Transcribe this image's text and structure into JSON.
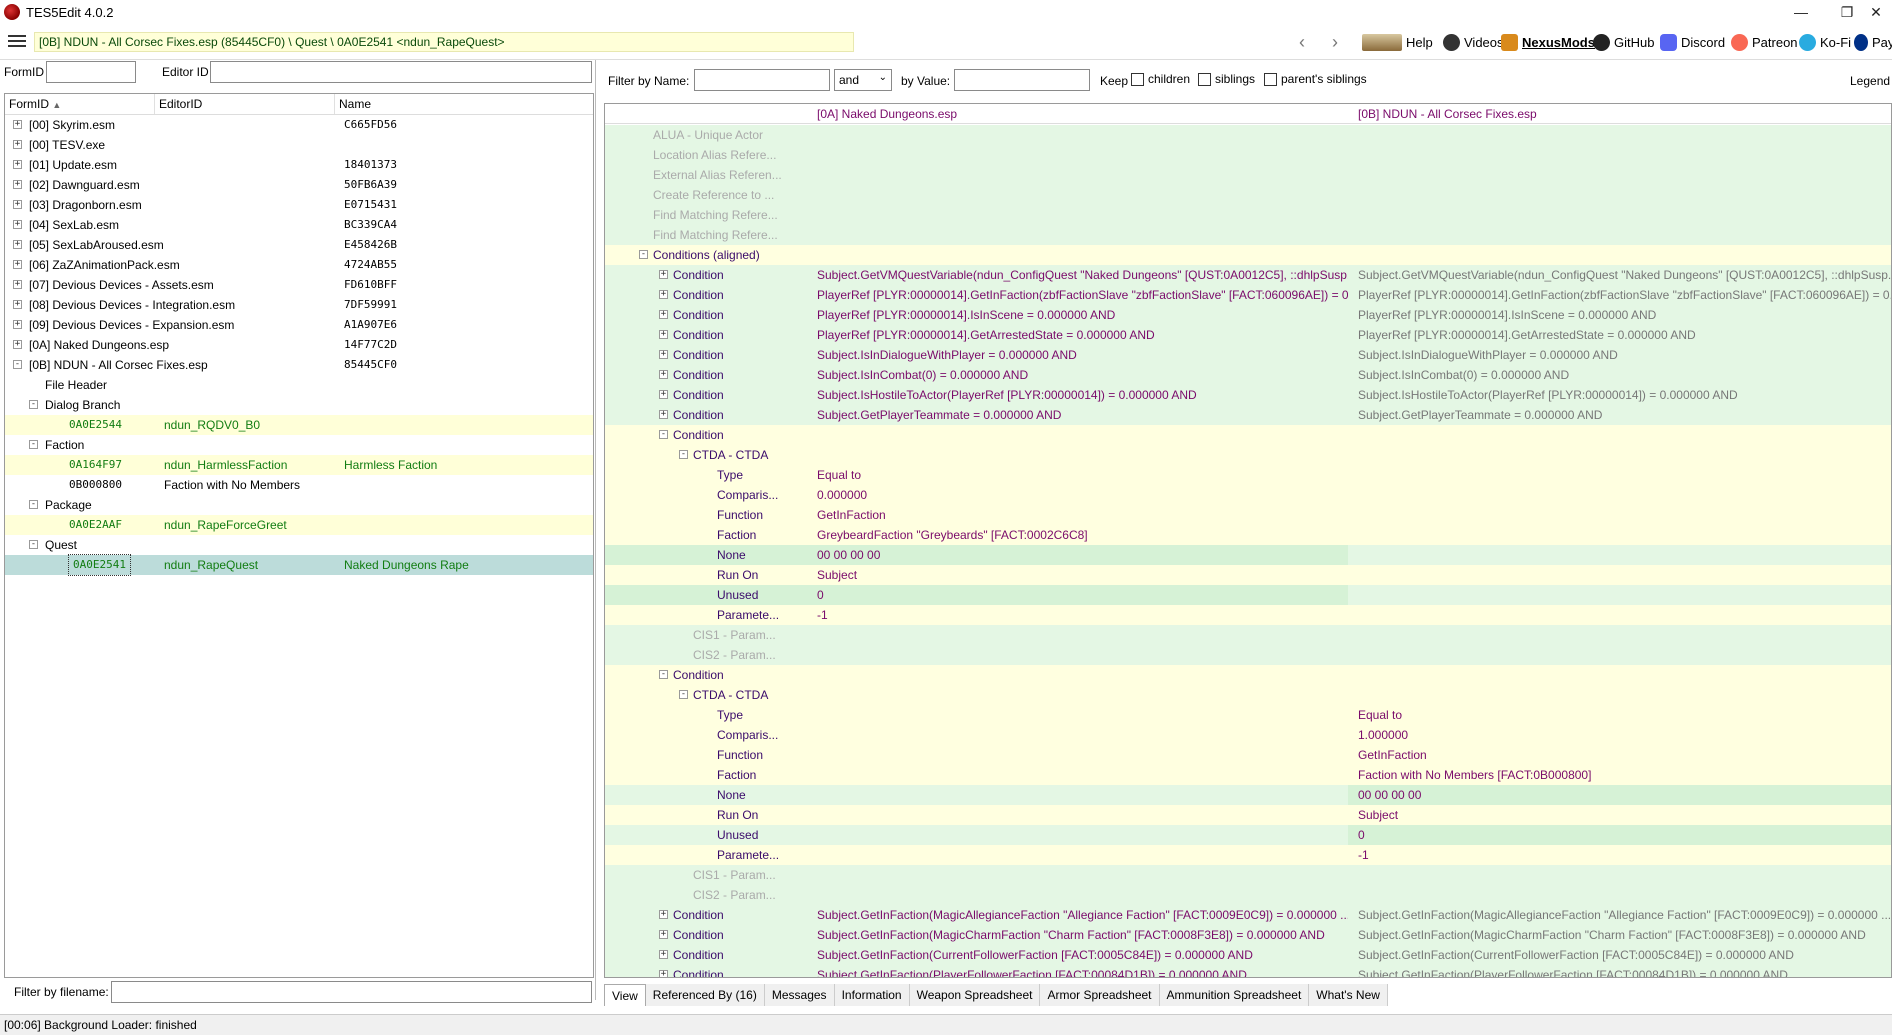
{
  "window": {
    "title": "TES5Edit 4.0.2"
  },
  "toolbar": {
    "path": "[0B] NDUN - All Corsec Fixes.esp (85445CF0) \\ Quest \\ 0A0E2541 <ndun_RapeQuest>",
    "links": [
      "Help",
      "Videos",
      "NexusMods",
      "GitHub",
      "Discord",
      "Patreon",
      "Ko-Fi",
      "Pay"
    ]
  },
  "left": {
    "formid_label": "FormID",
    "editorid_label": "Editor ID",
    "columns": [
      "FormID",
      "EditorID",
      "Name"
    ],
    "filter_label": "Filter by filename:",
    "rows": [
      {
        "label": "[00] Skyrim.esm",
        "id": "C665FD56",
        "name": ""
      },
      {
        "label": "[00] TESV.exe",
        "id": "",
        "name": ""
      },
      {
        "label": "[01] Update.esm",
        "id": "18401373",
        "name": ""
      },
      {
        "label": "[02] Dawnguard.esm",
        "id": "50FB6A39",
        "name": ""
      },
      {
        "label": "[03] Dragonborn.esm",
        "id": "E0715431",
        "name": ""
      },
      {
        "label": "[04] SexLab.esm",
        "id": "BC339CA4",
        "name": ""
      },
      {
        "label": "[05] SexLabAroused.esm",
        "id": "E458426B",
        "name": ""
      },
      {
        "label": "[06] ZaZAnimationPack.esm",
        "id": "4724AB55",
        "name": ""
      },
      {
        "label": "[07] Devious Devices - Assets.esm",
        "id": "FD610BFF",
        "name": ""
      },
      {
        "label": "[08] Devious Devices - Integration.esm",
        "id": "7DF59991",
        "name": ""
      },
      {
        "label": "[09] Devious Devices - Expansion.esm",
        "id": "A1A907E6",
        "name": ""
      },
      {
        "label": "[0A] Naked Dungeons.esp",
        "id": "14F77C2D",
        "name": ""
      },
      {
        "label": "[0B] NDUN - All Corsec Fixes.esp",
        "id": "85445CF0",
        "name": ""
      },
      {
        "label": "File Header",
        "id": "",
        "name": ""
      },
      {
        "label": "Dialog Branch",
        "id": "",
        "name": ""
      },
      {
        "label": "0A0E2544",
        "id": "ndun_RQDV0_B0",
        "name": ""
      },
      {
        "label": "Faction",
        "id": "",
        "name": ""
      },
      {
        "label": "0A164F97",
        "id": "ndun_HarmlessFaction",
        "name": "Harmless Faction"
      },
      {
        "label": "0B000800",
        "id": "Faction with No Members",
        "name": ""
      },
      {
        "label": "Package",
        "id": "",
        "name": ""
      },
      {
        "label": "0A0E2AAF",
        "id": "ndun_RapeForceGreet",
        "name": ""
      },
      {
        "label": "Quest",
        "id": "",
        "name": ""
      },
      {
        "label": "0A0E2541",
        "id": "ndun_RapeQuest",
        "name": "Naked Dungeons Rape"
      }
    ]
  },
  "right": {
    "filter_name_label": "Filter by Name:",
    "and_label": "and",
    "by_value_label": "by Value:",
    "keep_label": "Keep",
    "children_label": "children",
    "siblings_label": "siblings",
    "parents_label": "parent's siblings",
    "legend_label": "Legend",
    "col1": "[0A] Naked Dungeons.esp",
    "col2": "[0B] NDUN - All Corsec Fixes.esp",
    "rows": [
      {
        "name": "ALUA - Unique Actor",
        "v1": "",
        "v2": ""
      },
      {
        "name": "Location Alias Refere...",
        "v1": "",
        "v2": ""
      },
      {
        "name": "External Alias Referen...",
        "v1": "",
        "v2": ""
      },
      {
        "name": "Create Reference to ...",
        "v1": "",
        "v2": ""
      },
      {
        "name": "Find Matching Refere...",
        "v1": "",
        "v2": ""
      },
      {
        "name": "Find Matching Refere...",
        "v1": "",
        "v2": ""
      },
      {
        "name": "Conditions (aligned)",
        "v1": "",
        "v2": ""
      },
      {
        "name": "Condition",
        "v1": "Subject.GetVMQuestVariable(ndun_ConfigQuest \"Naked Dungeons\" [QUST:0A0012C5], ::dhlpSusp...",
        "v2": "Subject.GetVMQuestVariable(ndun_ConfigQuest \"Naked Dungeons\" [QUST:0A0012C5], ::dhlpSusp..."
      },
      {
        "name": "Condition",
        "v1": "PlayerRef [PLYR:00000014].GetInFaction(zbfFactionSlave \"zbfFactionSlave\" [FACT:060096AE]) = 0.0...",
        "v2": "PlayerRef [PLYR:00000014].GetInFaction(zbfFactionSlave \"zbfFactionSlave\" [FACT:060096AE]) = 0.0..."
      },
      {
        "name": "Condition",
        "v1": "PlayerRef [PLYR:00000014].IsInScene = 0.000000 AND",
        "v2": "PlayerRef [PLYR:00000014].IsInScene = 0.000000 AND"
      },
      {
        "name": "Condition",
        "v1": "PlayerRef [PLYR:00000014].GetArrestedState = 0.000000 AND",
        "v2": "PlayerRef [PLYR:00000014].GetArrestedState = 0.000000 AND"
      },
      {
        "name": "Condition",
        "v1": "Subject.IsInDialogueWithPlayer = 0.000000 AND",
        "v2": "Subject.IsInDialogueWithPlayer = 0.000000 AND"
      },
      {
        "name": "Condition",
        "v1": "Subject.IsInCombat(0) = 0.000000 AND",
        "v2": "Subject.IsInCombat(0) = 0.000000 AND"
      },
      {
        "name": "Condition",
        "v1": "Subject.IsHostileToActor(PlayerRef [PLYR:00000014]) = 0.000000 AND",
        "v2": "Subject.IsHostileToActor(PlayerRef [PLYR:00000014]) = 0.000000 AND"
      },
      {
        "name": "Condition",
        "v1": "Subject.GetPlayerTeammate = 0.000000 AND",
        "v2": "Subject.GetPlayerTeammate = 0.000000 AND"
      },
      {
        "name": "Condition",
        "v1": "",
        "v2": ""
      },
      {
        "name": "CTDA - CTDA",
        "v1": "",
        "v2": ""
      },
      {
        "name": "Type",
        "v1": "Equal to",
        "v2": ""
      },
      {
        "name": "Comparis...",
        "v1": "0.000000",
        "v2": ""
      },
      {
        "name": "Function",
        "v1": "GetInFaction",
        "v2": ""
      },
      {
        "name": "Faction",
        "v1": "GreybeardFaction \"Greybeards\" [FACT:0002C6C8]",
        "v2": ""
      },
      {
        "name": "None",
        "v1": "00 00 00 00",
        "v2": ""
      },
      {
        "name": "Run On",
        "v1": "Subject",
        "v2": ""
      },
      {
        "name": "Unused",
        "v1": "0",
        "v2": ""
      },
      {
        "name": "Paramete...",
        "v1": "-1",
        "v2": ""
      },
      {
        "name": "CIS1 - Param...",
        "v1": "",
        "v2": ""
      },
      {
        "name": "CIS2 - Param...",
        "v1": "",
        "v2": ""
      },
      {
        "name": "Condition",
        "v1": "",
        "v2": ""
      },
      {
        "name": "CTDA - CTDA",
        "v1": "",
        "v2": ""
      },
      {
        "name": "Type",
        "v1": "",
        "v2": "Equal to"
      },
      {
        "name": "Comparis...",
        "v1": "",
        "v2": "1.000000"
      },
      {
        "name": "Function",
        "v1": "",
        "v2": "GetInFaction"
      },
      {
        "name": "Faction",
        "v1": "",
        "v2": "Faction with No Members [FACT:0B000800]"
      },
      {
        "name": "None",
        "v1": "",
        "v2": "00 00 00 00"
      },
      {
        "name": "Run On",
        "v1": "",
        "v2": "Subject"
      },
      {
        "name": "Unused",
        "v1": "",
        "v2": "0"
      },
      {
        "name": "Paramete...",
        "v1": "",
        "v2": "-1"
      },
      {
        "name": "CIS1 - Param...",
        "v1": "",
        "v2": ""
      },
      {
        "name": "CIS2 - Param...",
        "v1": "",
        "v2": ""
      },
      {
        "name": "Condition",
        "v1": "Subject.GetInFaction(MagicAllegianceFaction \"Allegiance Faction\" [FACT:0009E0C9]) = 0.000000 ...",
        "v2": "Subject.GetInFaction(MagicAllegianceFaction \"Allegiance Faction\" [FACT:0009E0C9]) = 0.000000 ..."
      },
      {
        "name": "Condition",
        "v1": "Subject.GetInFaction(MagicCharmFaction \"Charm Faction\" [FACT:0008F3E8]) = 0.000000 AND",
        "v2": "Subject.GetInFaction(MagicCharmFaction \"Charm Faction\" [FACT:0008F3E8]) = 0.000000 AND"
      },
      {
        "name": "Condition",
        "v1": "Subject.GetInFaction(CurrentFollowerFaction [FACT:0005C84E]) = 0.000000 AND",
        "v2": "Subject.GetInFaction(CurrentFollowerFaction [FACT:0005C84E]) = 0.000000 AND"
      },
      {
        "name": "Condition",
        "v1": "Subject.GetInFaction(PlayerFollowerFaction [FACT:00084D1B]) = 0.000000 AND",
        "v2": "Subject.GetInFaction(PlayerFollowerFaction [FACT:00084D1B]) = 0.000000 AND"
      }
    ]
  },
  "tabs": [
    "View",
    "Referenced By (16)",
    "Messages",
    "Information",
    "Weapon Spreadsheet",
    "Armor Spreadsheet",
    "Ammunition Spreadsheet",
    "What's New"
  ],
  "status": "[00:06] Background Loader: finished"
}
